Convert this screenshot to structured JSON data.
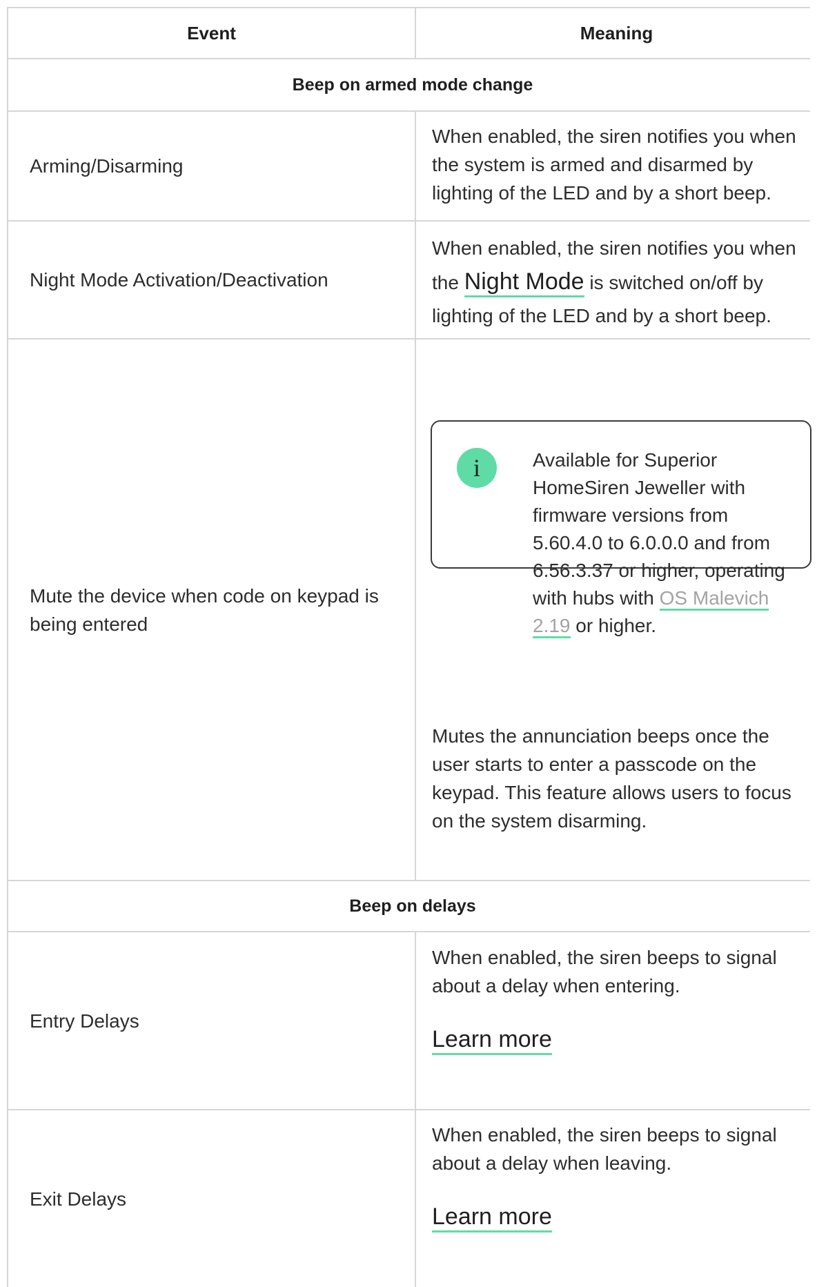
{
  "table": {
    "headers": {
      "event": "Event",
      "meaning": "Meaning"
    },
    "section_armed": "Beep on armed mode change",
    "row_arming": {
      "event": "Arming/Disarming",
      "meaning": "When enabled, the siren notifies you when the system is armed and disarmed by lighting of the LED and by a short beep."
    },
    "row_night": {
      "event": "Night Mode Activation/Deactivation",
      "meaning_before": "When enabled, the siren notifies you when the ",
      "meaning_link": "Night Mode",
      "meaning_after": " is switched on/off by lighting of the LED and by a short beep."
    },
    "row_mute": {
      "event": "Mute the device when code on keypad is being entered",
      "note_icon": "i",
      "note_before": "Available for Superior HomeSiren Jeweller with firmware versions from 5.60.4.0 to 6.0.0.0 and from 6.56.3.37 or higher, operating with hubs with ",
      "note_link": "OS Malevich 2.19",
      "note_after": " or higher.",
      "meaning": "Mutes the annunciation beeps once the user starts to enter a passcode on the keypad. This feature allows users to focus on the system disarming."
    },
    "section_delays": "Beep on delays",
    "row_entry": {
      "event": "Entry Delays",
      "meaning": "When enabled, the siren beeps to signal about a delay when entering.",
      "link": "Learn more"
    },
    "row_exit": {
      "event": "Exit Delays",
      "meaning": "When enabled, the siren beeps to signal about a delay when leaving.",
      "link": "Learn more"
    }
  },
  "colors": {
    "accent": "#5fdca6",
    "border": "#d6d6d6",
    "text": "#2d2d2d",
    "muted_link": "#a3a3a3"
  },
  "icons": {
    "note": "info-icon"
  }
}
